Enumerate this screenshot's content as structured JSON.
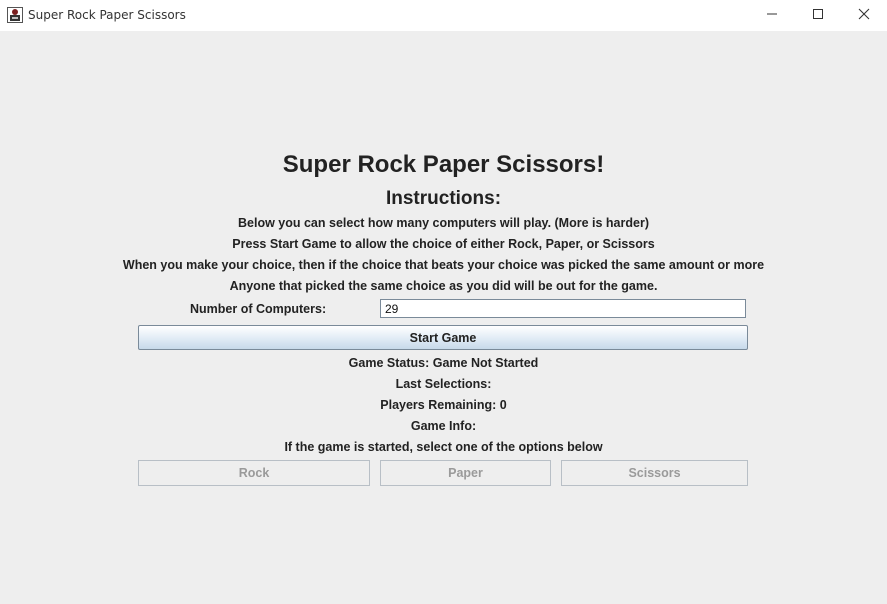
{
  "window": {
    "title": "Super Rock Paper Scissors",
    "controls": [
      "minimize-icon",
      "maximize-icon",
      "close-icon"
    ]
  },
  "main": {
    "heading": "Super Rock Paper Scissors!",
    "instructions_title": "Instructions:",
    "instructions": [
      "Below you can select how many computers will play. (More is harder)",
      "Press Start Game to allow the choice of either Rock, Paper, or Scissors",
      "When you make your choice, then if the choice that beats your choice was picked the same amount or more",
      "Anyone that picked the same choice as you did will be out for the game."
    ],
    "computers_label": "Number of Computers:",
    "computers_value": "29",
    "start_button": "Start Game",
    "game_status": "Game Status: Game Not Started",
    "last_selections": "Last Selections:",
    "players_remaining": "Players Remaining: 0",
    "game_info": "Game Info:",
    "prompt": "If the game is started, select one of the options below",
    "choices": {
      "rock": "Rock",
      "paper": "Paper",
      "scissors": "Scissors"
    },
    "choices_enabled": false
  },
  "colors": {
    "background": "#eeeeee",
    "titlebar": "#ffffff",
    "text": "#222222",
    "disabled_text": "#9a9a9a",
    "button_border": "#7a8a99"
  }
}
